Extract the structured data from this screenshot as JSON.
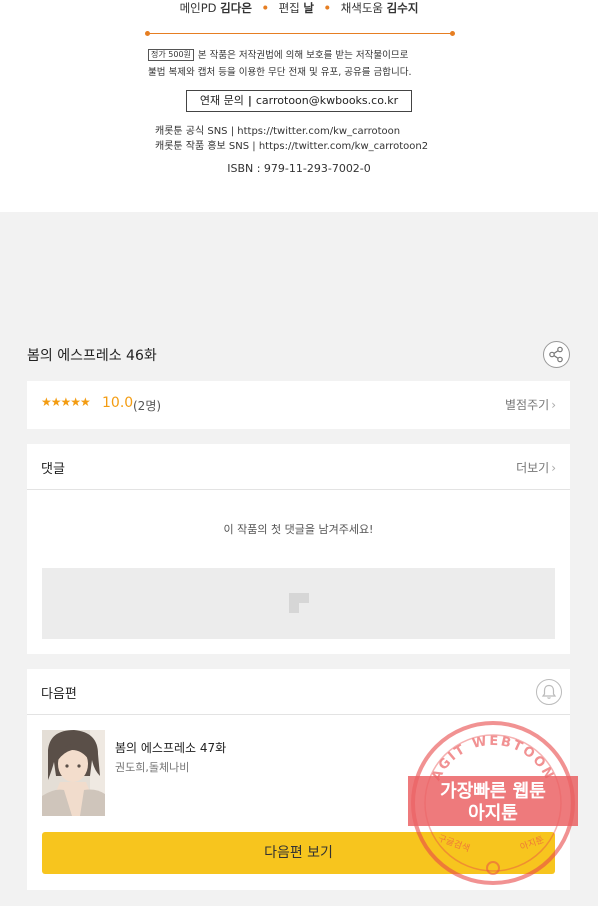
{
  "credits": {
    "main_pd_role": "메인PD",
    "main_pd_name": "김다은",
    "editor_role": "편집",
    "editor_name": "날",
    "coloring_role": "채색도움",
    "coloring_name": "김수지",
    "price_label": "정가 500원",
    "notice_line1": "본 작품은 저작권법에 의해 보호를 받는 저작물이므로",
    "notice_line2": "불법 복제와 캡처 등을 이용한 무단 전재 및 유포, 공유를 금합니다.",
    "contact_label": "연재 문의",
    "contact_sep": "|",
    "contact_email": "carrotoon@kwbooks.co.kr",
    "sns_line1": "캐롯툰 공식 SNS | https://twitter.com/kw_carrotoon",
    "sns_line2": "캐롯툰 작품 홍보 SNS | https://twitter.com/kw_carrotoon2",
    "isbn": "ISBN : 979-11-293-7002-0"
  },
  "episode": {
    "title": "봄의 에스프레소 46화",
    "share_icon": "share-icon"
  },
  "rating": {
    "stars": "★★★★★",
    "score": "10.0",
    "count": "(2명)",
    "rate_label": "별점주기",
    "accent_color": "#f39c12"
  },
  "comments": {
    "header": "댓글",
    "more_label": "더보기",
    "empty_message": "이 작품의 첫 댓글을 남겨주세요!"
  },
  "next_episode": {
    "header": "다음편",
    "bell_icon": "bell-icon",
    "title": "봄의 에스프레소 47화",
    "authors": "권도희,돌체나비",
    "button_label": "다음편 보기",
    "button_color": "#f7c51e"
  },
  "watermark": {
    "arc_text": "AGIT WEBTOON",
    "line1": "가장빠른 웹툰",
    "line2": "아지툰",
    "bottom_left": "구글검색",
    "bottom_right": "아지툰",
    "color": "#e8484a"
  }
}
